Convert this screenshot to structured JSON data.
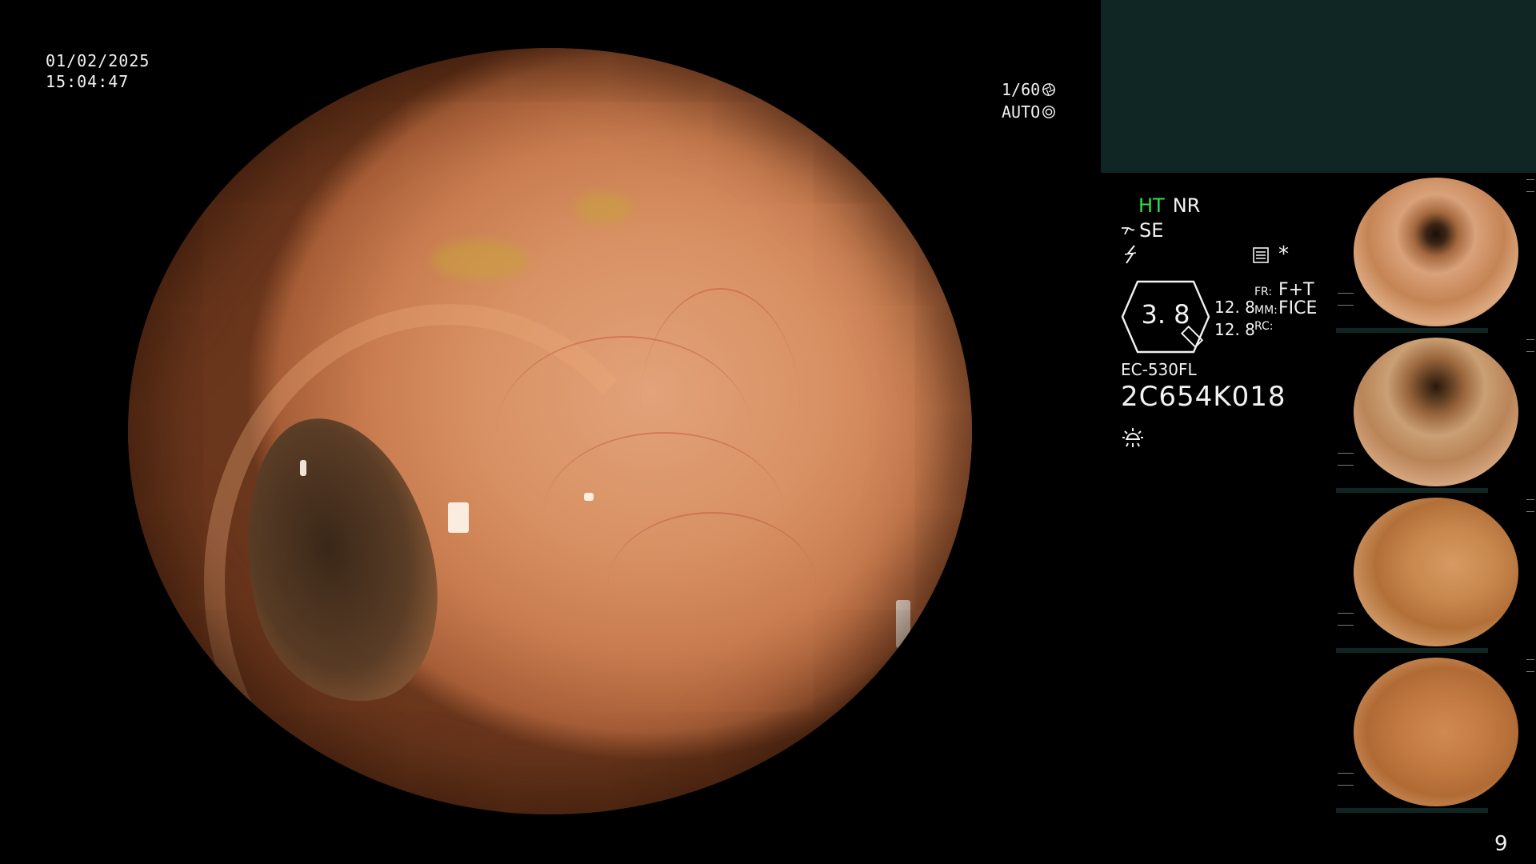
{
  "overlay": {
    "date": "01/02/2025",
    "time": "15:04:47",
    "shutter_speed": "1/60",
    "shutter_mode": "AUTO"
  },
  "settings": {
    "ht": "HT",
    "nr": "NR",
    "se": "SE",
    "zoom": "3. 8",
    "value_a": "12. 8",
    "value_b": "12. 8",
    "fr_label": "FR:",
    "fr_value": "F+T",
    "mm_label": "MM:",
    "mm_value": "FICE",
    "rc_label": "RC:",
    "rc_value": "",
    "star": "*",
    "ht_color": "#33e04a"
  },
  "scope": {
    "model": "EC-530FL",
    "serial": "2C654K018"
  },
  "thumbnails": {
    "count_label": "9"
  },
  "icons": {
    "shutter": "shutter-icon",
    "auto": "auto-iris-icon",
    "se": "se-mode-icon",
    "bolt": "bolt-icon",
    "menu": "menu-list-icon",
    "light": "light-icon"
  },
  "colors": {
    "panel": "#0f2624",
    "tissue": "#d79062"
  }
}
